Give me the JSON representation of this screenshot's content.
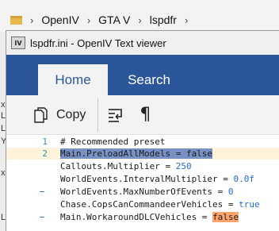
{
  "explorer": {
    "breadcrumb": [
      "OpenIV",
      "GTA V",
      "lspdfr"
    ],
    "left_strip_letters": [
      "x",
      "L",
      "L",
      "Y",
      "x",
      "L"
    ]
  },
  "viewer": {
    "title": "lspdfr.ini - OpenIV Text viewer",
    "app_icon_text": "IV",
    "tabs": [
      {
        "label": "Home",
        "active": true
      },
      {
        "label": "Search",
        "active": false
      }
    ],
    "toolbar": {
      "copy_label": "Copy",
      "wrap_icon": "word-wrap-icon",
      "pilcrow_icon": "¶"
    },
    "lines": [
      {
        "number": "1",
        "text": "# Recommended preset"
      },
      {
        "number": "2",
        "text": "Main.PreloadAllModels = false",
        "selected": true
      },
      {
        "number": "",
        "text_prefix": "Callouts.Multiplier = ",
        "value": "250"
      },
      {
        "number": "",
        "text_prefix": "WorldEvents.IntervalMultiplier = ",
        "value": "0.0f"
      },
      {
        "number": "",
        "text_prefix": "WorldEvents.MaxNumberOfEvents = ",
        "value": "0"
      },
      {
        "number": "",
        "text_prefix": "Chase.CopsCanCommandeerVehicles = ",
        "value": "true"
      },
      {
        "number": "",
        "text_prefix": "Main.WorkaroundDLCVehicles = ",
        "value": "false",
        "highlighted": true
      }
    ]
  },
  "colors": {
    "ribbon": "#2b579a",
    "selection": "#7891c5",
    "current_line": "#fff3dc",
    "search_highlight": "#ffa46b",
    "keyword": "#1e6bd6",
    "line_number": "#2b91af"
  }
}
